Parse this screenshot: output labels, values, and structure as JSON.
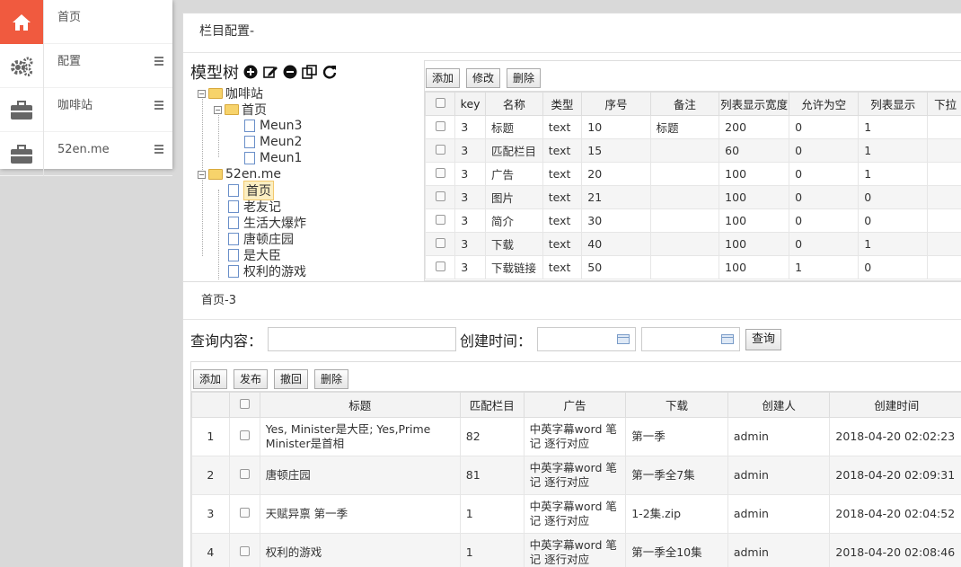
{
  "nav": {
    "items": [
      {
        "label": "首页",
        "icon": "home-icon",
        "active": true
      },
      {
        "label": "配置",
        "icon": "gears-icon"
      },
      {
        "label": "咖啡站",
        "icon": "briefcase-icon"
      },
      {
        "label": "52en.me",
        "icon": "briefcase-icon"
      }
    ]
  },
  "top_panel": {
    "title": "栏目配置-",
    "tree": {
      "title": "模型树",
      "toolbar_icons": [
        "add-icon",
        "edit-icon",
        "remove-icon",
        "copy-icon",
        "refresh-icon"
      ],
      "nodes": {
        "coffee": "咖啡站",
        "home": "首页",
        "meun3": "Meun3",
        "meun2": "Meun2",
        "meun1": "Meun1",
        "site52": "52en.me",
        "home2": "首页",
        "n1": "老友记",
        "n2": "生活大爆炸",
        "n3": "唐顿庄园",
        "n4": "是大臣",
        "n5": "权利的游戏"
      }
    },
    "toolbar": {
      "add": "添加",
      "edit": "修改",
      "delete": "删除"
    },
    "columns": [
      "key",
      "名称",
      "类型",
      "序号",
      "备注",
      "列表显示宽度",
      "允许为空",
      "列表显示",
      "下拉"
    ],
    "rows": [
      [
        "3",
        "标题",
        "text",
        "10",
        "标题",
        "200",
        "0",
        "1"
      ],
      [
        "3",
        "匹配栏目",
        "text",
        "15",
        "",
        "60",
        "0",
        "1"
      ],
      [
        "3",
        "广告",
        "text",
        "20",
        "",
        "100",
        "0",
        "1"
      ],
      [
        "3",
        "图片",
        "text",
        "21",
        "",
        "100",
        "0",
        "0"
      ],
      [
        "3",
        "简介",
        "text",
        "30",
        "",
        "100",
        "0",
        "0"
      ],
      [
        "3",
        "下载",
        "text",
        "40",
        "",
        "100",
        "0",
        "1"
      ],
      [
        "3",
        "下载链接",
        "text",
        "50",
        "",
        "100",
        "1",
        "0"
      ]
    ]
  },
  "bottom_panel": {
    "title": "首页-3",
    "search": {
      "label": "查询内容：",
      "value": "",
      "date_label": "创建时间：",
      "date_from": "",
      "date_to": "",
      "button": "查询"
    },
    "toolbar": {
      "add": "添加",
      "publish": "发布",
      "revoke": "撤回",
      "delete": "删除"
    },
    "columns": [
      "标题",
      "匹配栏目",
      "广告",
      "下载",
      "创建人",
      "创建时间"
    ],
    "rows": [
      [
        "1",
        "Yes, Minister是大臣; Yes,Prime Minister是首相",
        "82",
        "中英字幕word 笔记 逐行对应",
        "第一季",
        "admin",
        "2018-04-20 02:02:23"
      ],
      [
        "2",
        "唐顿庄园",
        "81",
        "中英字幕word 笔记 逐行对应",
        "第一季全7集",
        "admin",
        "2018-04-20 02:09:31"
      ],
      [
        "3",
        "天赋异禀 第一季",
        "1",
        "中英字幕word 笔记 逐行对应",
        "1-2集.zip",
        "admin",
        "2018-04-20 02:04:52"
      ],
      [
        "4",
        "权利的游戏",
        "1",
        "中英字幕word 笔记 逐行对应",
        "第一季全10集",
        "admin",
        "2018-04-20 02:08:46"
      ]
    ]
  }
}
